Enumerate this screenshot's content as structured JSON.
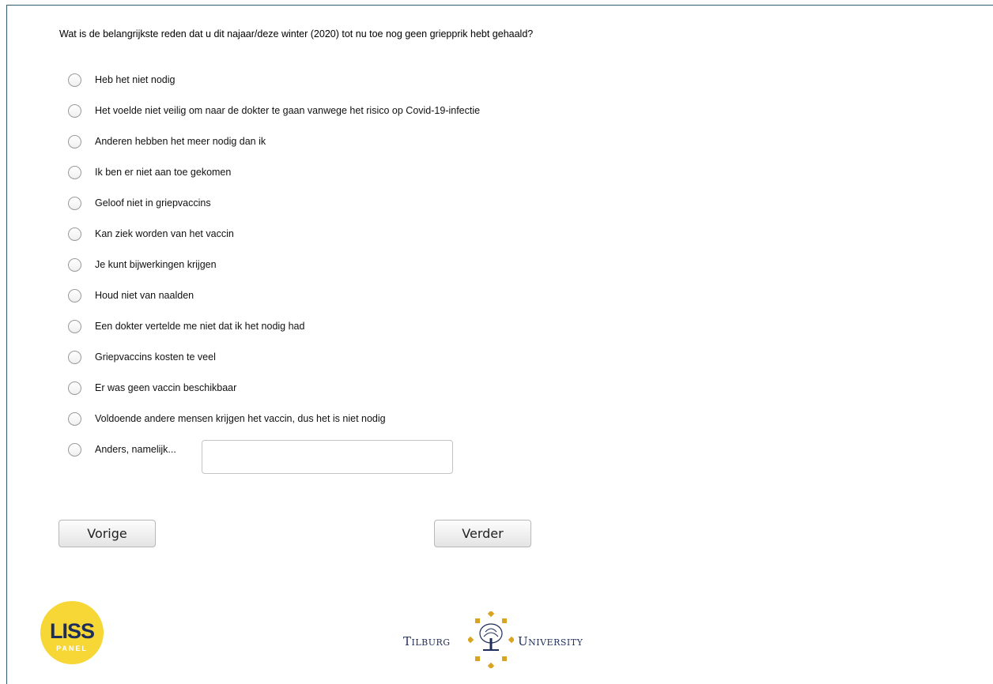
{
  "question": "Wat is de belangrijkste reden dat u dit najaar/deze winter (2020) tot nu toe nog geen griepprik hebt gehaald?",
  "options": [
    "Heb het niet nodig",
    "Het voelde niet veilig om naar de dokter te gaan vanwege het risico op Covid-19-infectie",
    "Anderen hebben het meer nodig dan ik",
    "Ik ben er niet aan toe gekomen",
    "Geloof niet in griepvaccins",
    "Kan ziek worden van het vaccin",
    "Je kunt bijwerkingen krijgen",
    "Houd niet van naalden",
    "Een dokter vertelde me niet dat ik het nodig had",
    "Griepvaccins kosten te veel",
    "Er was geen vaccin beschikbaar",
    "Voldoende andere mensen krijgen het vaccin, dus het is niet nodig",
    "Anders, namelijk..."
  ],
  "other_input_value": "",
  "buttons": {
    "previous": "Vorige",
    "next": "Verder"
  },
  "logos": {
    "liss_text": "LISS",
    "liss_sub": "PANEL",
    "tilburg_left": "Tilburg",
    "tilburg_right": "University"
  },
  "colors": {
    "liss_yellow": "#f6d735",
    "tilburg_gold": "#d9a520",
    "tilburg_navy": "#1d2d5c",
    "frame": "#2f5d6e"
  }
}
